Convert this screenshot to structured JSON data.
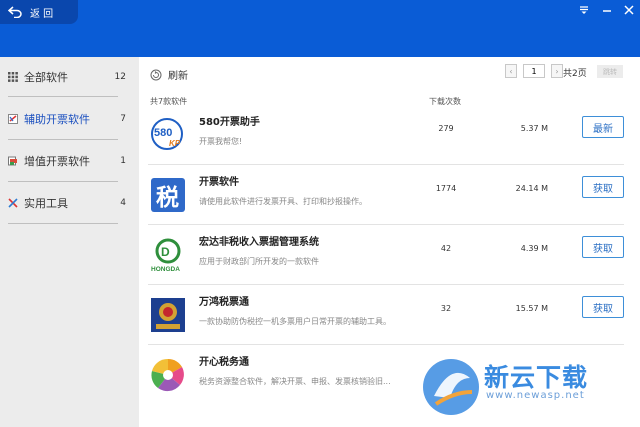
{
  "titlebar": {
    "back_label": "返 回",
    "menu_icon": "menu-icon",
    "minimize_icon": "minimize-icon",
    "close_icon": "close-icon"
  },
  "sidebar": {
    "categories": [
      {
        "label": "全部软件",
        "count": "12",
        "icon": "grid-icon"
      },
      {
        "label": "辅助开票软件",
        "count": "7",
        "icon": "invoice-assist-icon",
        "active": true
      },
      {
        "label": "增值开票软件",
        "count": "1",
        "icon": "vat-invoice-icon"
      },
      {
        "label": "实用工具",
        "count": "4",
        "icon": "tools-icon"
      }
    ]
  },
  "toolbar": {
    "refresh_label": "刷新"
  },
  "pager": {
    "prev": "‹",
    "page_value": "1",
    "next": "›",
    "total_pages": "共2页",
    "go_label": "跳转"
  },
  "list": {
    "total_label": "共7款软件",
    "download_header": "下载次数",
    "items": [
      {
        "name": "580开票助手",
        "desc": "开票我帮您!",
        "downloads": "279",
        "size": "5.37 M",
        "action": "最新",
        "icon": "kp580-logo-icon"
      },
      {
        "name": "开票软件",
        "desc": "请使用此软件进行发票开具、打印和抄报操作。",
        "downloads": "1774",
        "size": "24.14 M",
        "action": "获取",
        "icon": "tax-logo-icon"
      },
      {
        "name": "宏达非税收入票据管理系统",
        "desc": "应用于财政部门所开发的一款软件",
        "downloads": "42",
        "size": "4.39 M",
        "action": "获取",
        "icon": "hongda-logo-icon"
      },
      {
        "name": "万鸿税票通",
        "desc": "一款协助防伪税控一机多票用户日常开票的辅助工具。",
        "downloads": "32",
        "size": "15.57 M",
        "action": "获取",
        "icon": "tax-emblem-icon"
      },
      {
        "name": "开心税务通",
        "desc": "税务资源整合软件，解决开票、申报、发票核销验旧...",
        "downloads": "",
        "size": "",
        "action": "",
        "icon": "happy-tax-logo-icon"
      }
    ]
  },
  "hongda_text": "HONGDA",
  "kp580_text": "580",
  "kp_sub": "KP",
  "tax_char": "税",
  "watermark": {
    "brand": "新云下载",
    "url": "www.newasp.net"
  },
  "colors": {
    "titlebar": "#0a5cd6",
    "accent": "#2b6fc4",
    "sidebar_bg": "#ececec"
  }
}
